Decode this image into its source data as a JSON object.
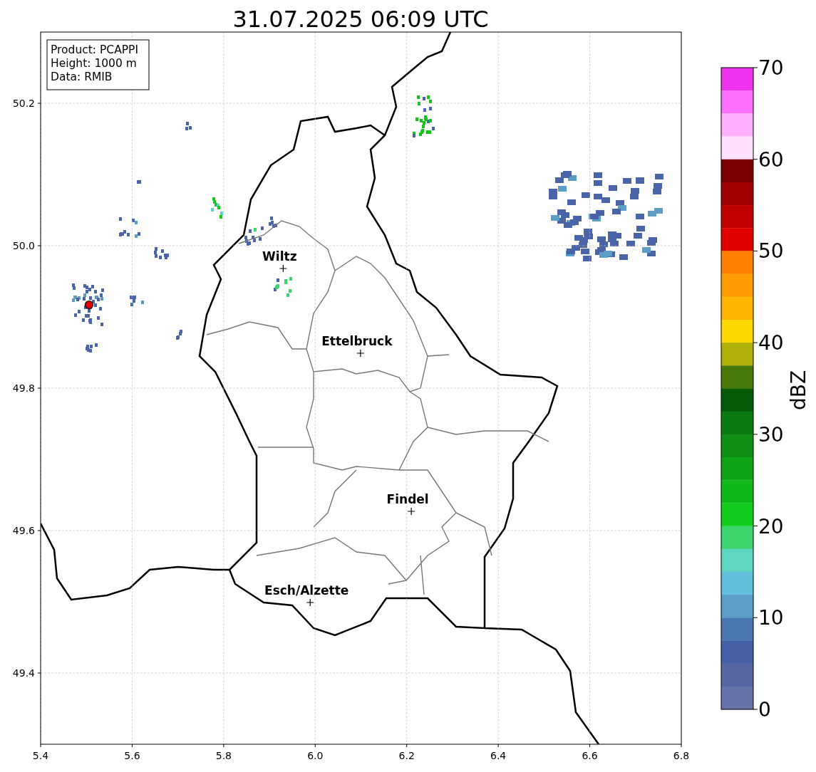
{
  "title": "31.07.2025 06:09 UTC",
  "info_box": [
    "Product: PCAPPI",
    "Height: 1000 m",
    "Data: RMIB"
  ],
  "map": {
    "chart_data": {
      "type": "scatter",
      "grid": true,
      "xlim": [
        5.4,
        6.8
      ],
      "ylim": [
        49.3,
        50.3
      ],
      "xticks": [
        {
          "value": 5.4,
          "label": "5.4"
        },
        {
          "value": 5.6,
          "label": "5.6"
        },
        {
          "value": 5.8,
          "label": "5.8"
        },
        {
          "value": 6.0,
          "label": "6.0"
        },
        {
          "value": 6.2,
          "label": "6.2"
        },
        {
          "value": 6.4,
          "label": "6.4"
        },
        {
          "value": 6.6,
          "label": "6.6"
        },
        {
          "value": 6.8,
          "label": "6.8"
        }
      ],
      "yticks": [
        {
          "value": 49.4,
          "label": "49.4"
        },
        {
          "value": 49.6,
          "label": "49.6"
        },
        {
          "value": 49.8,
          "label": "49.8"
        },
        {
          "value": 50.0,
          "label": "50.0"
        },
        {
          "value": 50.2,
          "label": "50.2"
        }
      ],
      "x": [
        5.93,
        6.099,
        6.21,
        5.989
      ],
      "series": [
        {
          "color": "#000000",
          "values": [
            49.968,
            49.849,
            49.627,
            49.499
          ]
        }
      ],
      "annotations": [
        {
          "x": 5.93,
          "y": 49.968,
          "text": "Wiltz"
        },
        {
          "x": 6.099,
          "y": 49.849,
          "text": "Ettelbruck"
        },
        {
          "x": 6.21,
          "y": 49.627,
          "text": "Findel"
        },
        {
          "x": 5.989,
          "y": 49.499,
          "text": "Esch/Alzette"
        }
      ]
    }
  },
  "colorbar": {
    "label": "dBZ",
    "ticks": [
      "70",
      "60",
      "50",
      "40",
      "30",
      "20",
      "10",
      "0"
    ],
    "segments": [
      {
        "color": "#ee33ee"
      },
      {
        "color": "#ff70ff"
      },
      {
        "color": "#ffb0ff"
      },
      {
        "color": "#ffe0ff"
      },
      {
        "color": "#780000"
      },
      {
        "color": "#a00000"
      },
      {
        "color": "#c00000"
      },
      {
        "color": "#e00000"
      },
      {
        "color": "#ff8000"
      },
      {
        "color": "#ff9c00"
      },
      {
        "color": "#ffb400"
      },
      {
        "color": "#ffd800"
      },
      {
        "color": "#b0b008"
      },
      {
        "color": "#487808"
      },
      {
        "color": "#055a08"
      },
      {
        "color": "#0b7a10"
      },
      {
        "color": "#0e8e12"
      },
      {
        "color": "#0fa416"
      },
      {
        "color": "#10b81a"
      },
      {
        "color": "#12cc1c"
      },
      {
        "color": "#3cd46c"
      },
      {
        "color": "#5fd6c0"
      },
      {
        "color": "#62c0dc"
      },
      {
        "color": "#5a9ec6"
      },
      {
        "color": "#4a78b0"
      },
      {
        "color": "#4560a4"
      },
      {
        "color": "#5567a0"
      },
      {
        "color": "#6474a8"
      }
    ]
  }
}
